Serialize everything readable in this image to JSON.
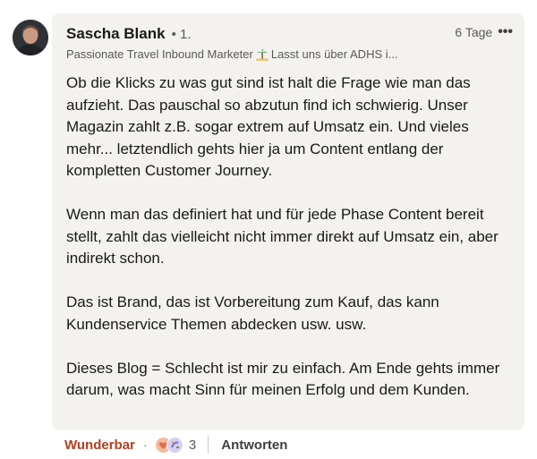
{
  "comment": {
    "author_name": "Sascha Blank",
    "degree": "• 1.",
    "headline_part1": "Passionate Travel Inbound Marketer",
    "headline_part2": "Lasst uns über ADHS i...",
    "timestamp": "6 Tage",
    "more_glyph": "•••",
    "paragraphs": [
      "Ob die Klicks zu was gut sind ist halt die Frage wie man das aufzieht. Das pauschal so abzutun find ich schwierig. Unser Magazin zahlt z.B. sogar extrem auf Umsatz ein. Und vieles mehr... letztendlich gehts hier ja um Content entlang der kompletten Customer Journey.",
      "Wenn man das definiert hat und für jede Phase Content bereit stellt, zahlt das vielleicht nicht immer direkt auf Umsatz ein, aber indirekt schon.",
      "Das ist Brand, das ist Vorbereitung zum Kauf, das kann Kundenservice Themen abdecken usw. usw.",
      "Dieses Blog = Schlecht ist mir zu einfach. Am Ende gehts immer darum, was macht Sinn für meinen Erfolg und dem Kunden."
    ]
  },
  "actions": {
    "reaction_label": "Wunderbar",
    "separator_dot": "·",
    "reaction_count": "3",
    "reply_label": "Antworten"
  },
  "colors": {
    "bubble_bg": "#f3f2ef",
    "reaction_label": "#b24020",
    "secondary_text": "#595959"
  },
  "icons": {
    "headline_emoji": "palm-tree-icon",
    "reactions": [
      "love-reaction-icon",
      "celebrate-reaction-icon"
    ]
  }
}
